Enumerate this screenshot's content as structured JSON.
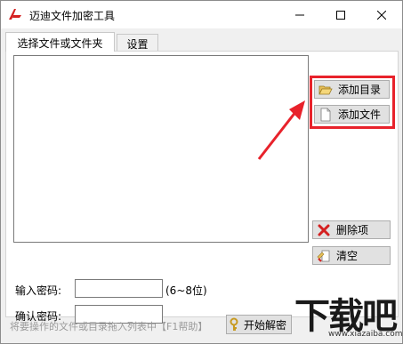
{
  "window": {
    "title": "迈迪文件加密工具",
    "app_icon": "app-logo-icon",
    "controls": [
      "minimize-icon",
      "maximize-icon",
      "close-icon"
    ]
  },
  "tabs": [
    {
      "label": "选择文件或文件夹",
      "active": true
    },
    {
      "label": "设置",
      "active": false
    }
  ],
  "buttons": {
    "add_directory": {
      "label": "添加目录",
      "icon": "folder-open-icon"
    },
    "add_file": {
      "label": "添加文件",
      "icon": "file-icon"
    },
    "delete_item": {
      "label": "删除项",
      "icon": "delete-x-icon"
    },
    "clear": {
      "label": "清空",
      "icon": "clear-icon"
    },
    "start": {
      "label": "开始解密",
      "icon": "key-icon"
    }
  },
  "password": {
    "label": "输入密码:",
    "value": "",
    "hint": "(6~8位)"
  },
  "confirm_password": {
    "label": "确认密码:",
    "value": ""
  },
  "status": {
    "text": "将要操作的文件或目录拖入列表中【F1帮助】"
  },
  "watermark": {
    "text": "下载吧",
    "url": "www.xiazaiba.com"
  },
  "colors": {
    "highlight": "#e8222b",
    "button_face": "#e1e1e1",
    "panel_bg": "#f0f0f0"
  }
}
